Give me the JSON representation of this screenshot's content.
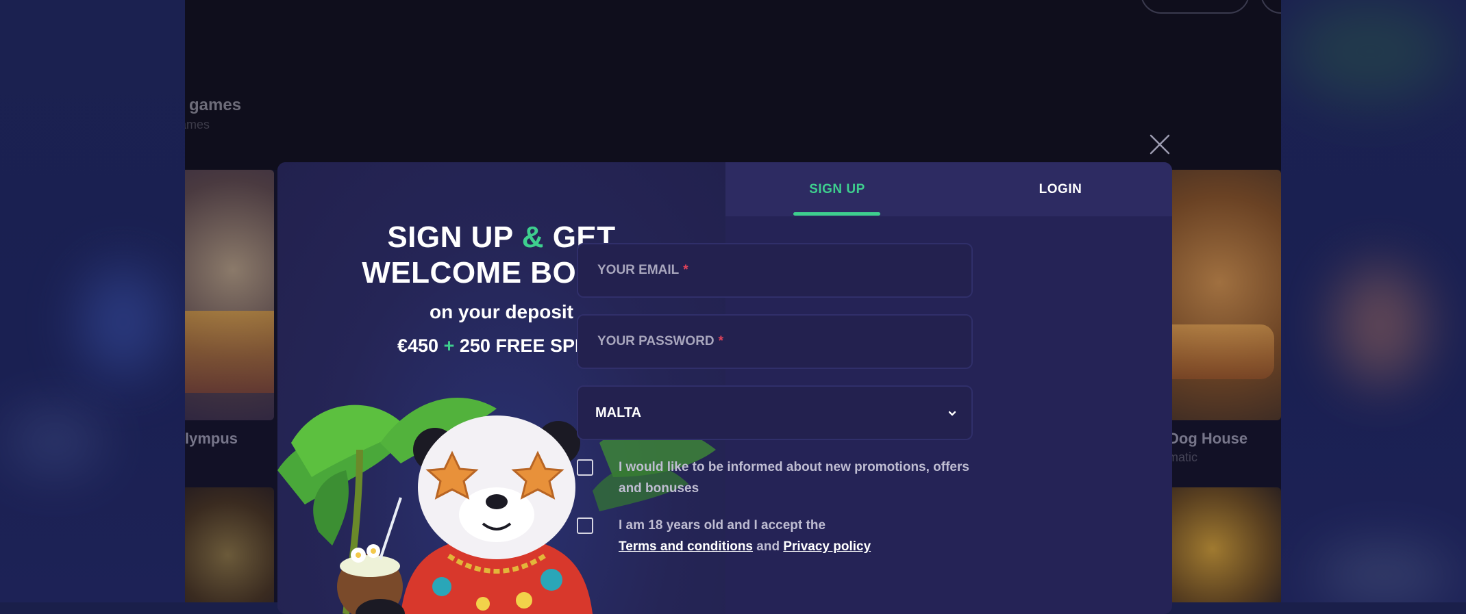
{
  "background_site": {
    "section_title": "games",
    "section_subtitle": "ames",
    "games": [
      {
        "name": "lympus",
        "provider": ""
      },
      {
        "name": "Dog House",
        "provider": "matic"
      }
    ]
  },
  "modal": {
    "close_icon": "close-icon",
    "promo": {
      "title_part1": "SIGN UP",
      "title_amp": "&",
      "title_part2": "GET",
      "title_line2": "WELCOME BONUS",
      "subtitle": "on your deposit",
      "offer_part1": "€450",
      "offer_plus": "+",
      "offer_part2": "250 FREE SPINS"
    },
    "tabs": [
      {
        "label": "SIGN UP",
        "active": true
      },
      {
        "label": "LOGIN",
        "active": false
      }
    ],
    "form": {
      "email_placeholder": "YOUR EMAIL",
      "password_placeholder": "YOUR PASSWORD",
      "required_mark": "*",
      "country_value": "MALTA",
      "promo_consent": "I would like to be informed about new promotions, offers and bonuses",
      "age_consent_prefix": "I am 18 years old and I accept the",
      "terms_link": "Terms and conditions",
      "and_text": "and",
      "privacy_link": "Privacy policy"
    },
    "colors": {
      "accent": "#3ecf8e",
      "modal_bg": "#252356",
      "required": "#e2435a"
    }
  }
}
